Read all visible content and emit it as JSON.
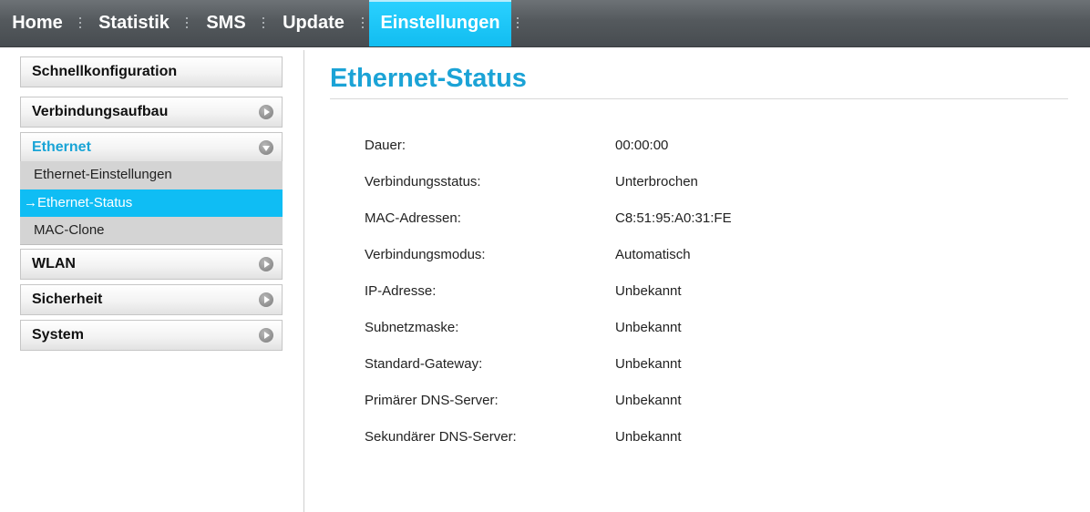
{
  "nav": {
    "items": [
      {
        "label": "Home"
      },
      {
        "label": "Statistik"
      },
      {
        "label": "SMS"
      },
      {
        "label": "Update"
      },
      {
        "label": "Einstellungen",
        "active": true
      }
    ]
  },
  "sidebar": {
    "items": [
      {
        "label": "Schnellkonfiguration"
      },
      {
        "label": "Verbindungsaufbau",
        "icon": "chevron-right-icon"
      },
      {
        "label": "Ethernet",
        "icon": "chevron-down-icon",
        "expanded": true,
        "subitems": [
          {
            "label": "Ethernet-Einstellungen"
          },
          {
            "label": "→Ethernet-Status",
            "selected": true
          },
          {
            "label": "MAC-Clone"
          }
        ]
      },
      {
        "label": "WLAN",
        "icon": "chevron-right-icon"
      },
      {
        "label": "Sicherheit",
        "icon": "chevron-right-icon"
      },
      {
        "label": "System",
        "icon": "chevron-right-icon"
      }
    ]
  },
  "main": {
    "title": "Ethernet-Status",
    "rows": [
      {
        "label": "Dauer:",
        "value": "00:00:00"
      },
      {
        "label": "Verbindungsstatus:",
        "value": "Unterbrochen"
      },
      {
        "label": "MAC-Adressen:",
        "value": "C8:51:95:A0:31:FE"
      },
      {
        "label": "Verbindungsmodus:",
        "value": "Automatisch"
      },
      {
        "label": "IP-Adresse:",
        "value": "Unbekannt"
      },
      {
        "label": "Subnetzmaske:",
        "value": "Unbekannt"
      },
      {
        "label": "Standard-Gateway:",
        "value": "Unbekannt"
      },
      {
        "label": "Primärer DNS-Server:",
        "value": "Unbekannt"
      },
      {
        "label": "Sekundärer DNS-Server:",
        "value": "Unbekannt"
      }
    ]
  },
  "colors": {
    "accent": "#1ba3d6",
    "active_tab": "#12bdf0",
    "nav_bg": "#54595d"
  }
}
